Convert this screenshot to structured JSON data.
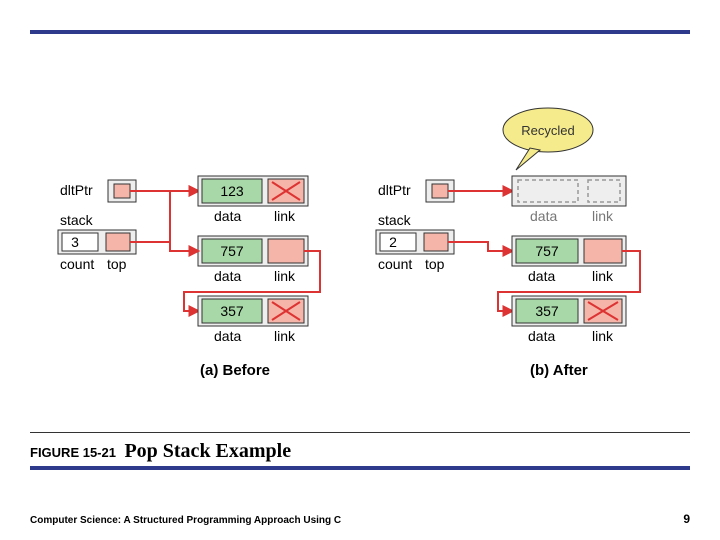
{
  "figure_number": "FIGURE 15-21",
  "figure_title": "Pop Stack Example",
  "footer": "Computer Science: A Structured Programming Approach Using C",
  "page": "9",
  "labels": {
    "dltPtr": "dltPtr",
    "stack": "stack",
    "count": "count",
    "top": "top",
    "data": "data",
    "link": "link",
    "before": "(a) Before",
    "after": "(b) After",
    "recycled": "Recycled"
  },
  "before": {
    "count": "3",
    "nodes": [
      {
        "value": "123",
        "link_null": true
      },
      {
        "value": "757",
        "link_null": false
      },
      {
        "value": "357",
        "link_null": true
      }
    ]
  },
  "after": {
    "count": "2",
    "deleted_node": {
      "value": "",
      "link_null": false
    },
    "nodes": [
      {
        "value": "757",
        "link_null": false
      },
      {
        "value": "357",
        "link_null": true
      }
    ]
  },
  "chart_data": {
    "type": "diagram",
    "description": "Linked stack pop operation: state before and after deleting top node (123). Before: count=3, top->123->? , second 757 -> 357. After: node 123 recycled, count=2, top->757->357.",
    "before_stack": [
      "123",
      "757",
      "357"
    ],
    "after_stack": [
      "757",
      "357"
    ],
    "popped_value": "123"
  }
}
